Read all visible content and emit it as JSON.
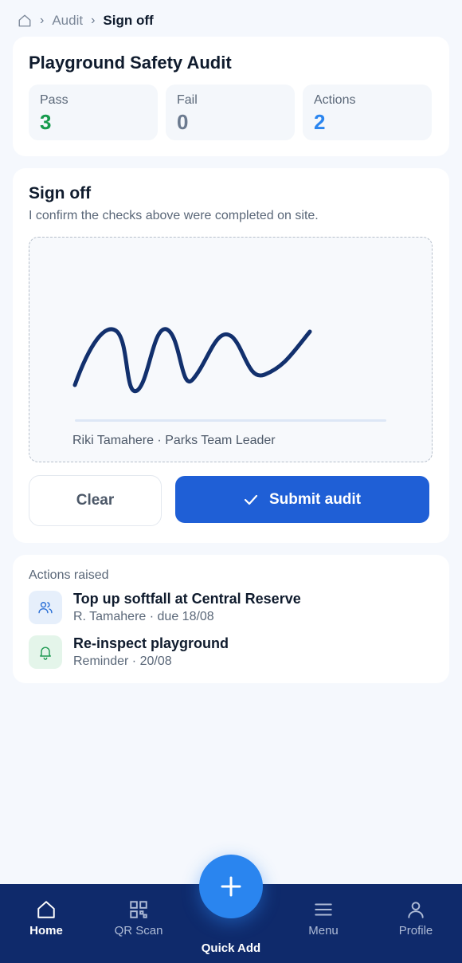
{
  "breadcrumb": {
    "parent": "Audit",
    "current": "Sign off"
  },
  "summary": {
    "title": "Playground Safety Audit",
    "stats": [
      {
        "label": "Pass",
        "value": "3",
        "color": "#169a4c"
      },
      {
        "label": "Fail",
        "value": "0",
        "color": "#6b7a8f"
      },
      {
        "label": "Actions",
        "value": "2",
        "color": "#2a85ef"
      }
    ]
  },
  "signoff": {
    "title": "Sign off",
    "subtitle": "I confirm the checks above were completed on site.",
    "signer": "Riki Tamahere · Parks Team Leader",
    "clear_label": "Clear",
    "submit_label": "Submit audit"
  },
  "actions": {
    "label": "Actions raised",
    "items": [
      {
        "title": "Top up softfall at Central Reserve",
        "meta": "R. Tamahere · due 18/08",
        "icon": "users-icon"
      },
      {
        "title": "Re-inspect playground",
        "meta": "Reminder · 20/08",
        "icon": "bell-icon"
      }
    ]
  },
  "nav": {
    "items": [
      {
        "label": "Home",
        "icon": "home-icon"
      },
      {
        "label": "QR Scan",
        "icon": "qr-icon"
      },
      {
        "label": "Menu",
        "icon": "menu-icon"
      },
      {
        "label": "Profile",
        "icon": "profile-icon"
      }
    ],
    "quick_add_label": "Quick Add"
  },
  "colors": {
    "accent": "#1f5fd6",
    "nav_bg": "#0f2a6b",
    "fab": "#2a85ef"
  }
}
